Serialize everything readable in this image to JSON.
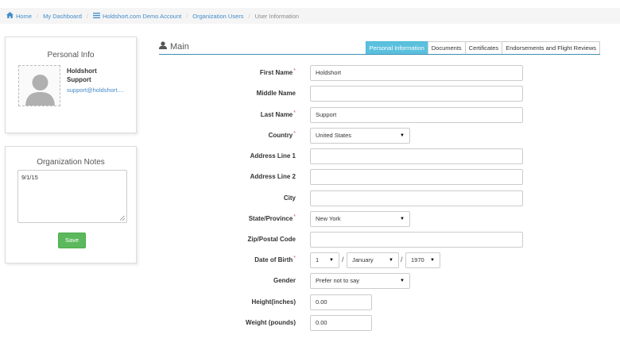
{
  "breadcrumb": {
    "home": "Home",
    "dashboard": "My Dashboard",
    "account": "Holdshort.com Demo Account",
    "org_users": "Organization Users",
    "current": "User Information",
    "icons": {
      "home": "home-icon",
      "account": "list-icon"
    }
  },
  "personal_info": {
    "title": "Personal Info",
    "name_line1": "Holdshort",
    "name_line2": "Support",
    "email": "support@holdshort...."
  },
  "org_notes": {
    "title": "Organization Notes",
    "text": "9/1/15",
    "save_label": "Save"
  },
  "main": {
    "title": "Main",
    "tabs": [
      {
        "label": "Personal Information",
        "active": true
      },
      {
        "label": "Documents",
        "active": false
      },
      {
        "label": "Certificates",
        "active": false
      },
      {
        "label": "Endorsements and Flight Reviews",
        "active": false
      }
    ]
  },
  "form": {
    "first_name": {
      "label": "First Name",
      "value": "Holdshort",
      "required": true
    },
    "middle_name": {
      "label": "Middle Name",
      "value": ""
    },
    "last_name": {
      "label": "Last Name",
      "value": "Support",
      "required": true
    },
    "country": {
      "label": "Country",
      "value": "United States",
      "required": true
    },
    "address1": {
      "label": "Address Line 1",
      "value": ""
    },
    "address2": {
      "label": "Address Line 2",
      "value": ""
    },
    "city": {
      "label": "City",
      "value": ""
    },
    "state": {
      "label": "State/Province",
      "value": "New York",
      "required": true
    },
    "zip": {
      "label": "Zip/Postal Code",
      "value": ""
    },
    "dob": {
      "label": "Date of Birth",
      "day": "1",
      "month": "January",
      "year": "1970",
      "required": true,
      "separator": "/"
    },
    "gender": {
      "label": "Gender",
      "value": "Prefer not to say"
    },
    "height": {
      "label": "Height(inches)",
      "value": "0.00"
    },
    "weight": {
      "label": "Weight (pounds)",
      "value": "0.00"
    },
    "required_marker": "*"
  },
  "colors": {
    "link": "#428bca",
    "accent_tab": "#5bc0de",
    "save": "#5cb85c",
    "required": "#d9534f",
    "rule": "#3e8fb0"
  }
}
